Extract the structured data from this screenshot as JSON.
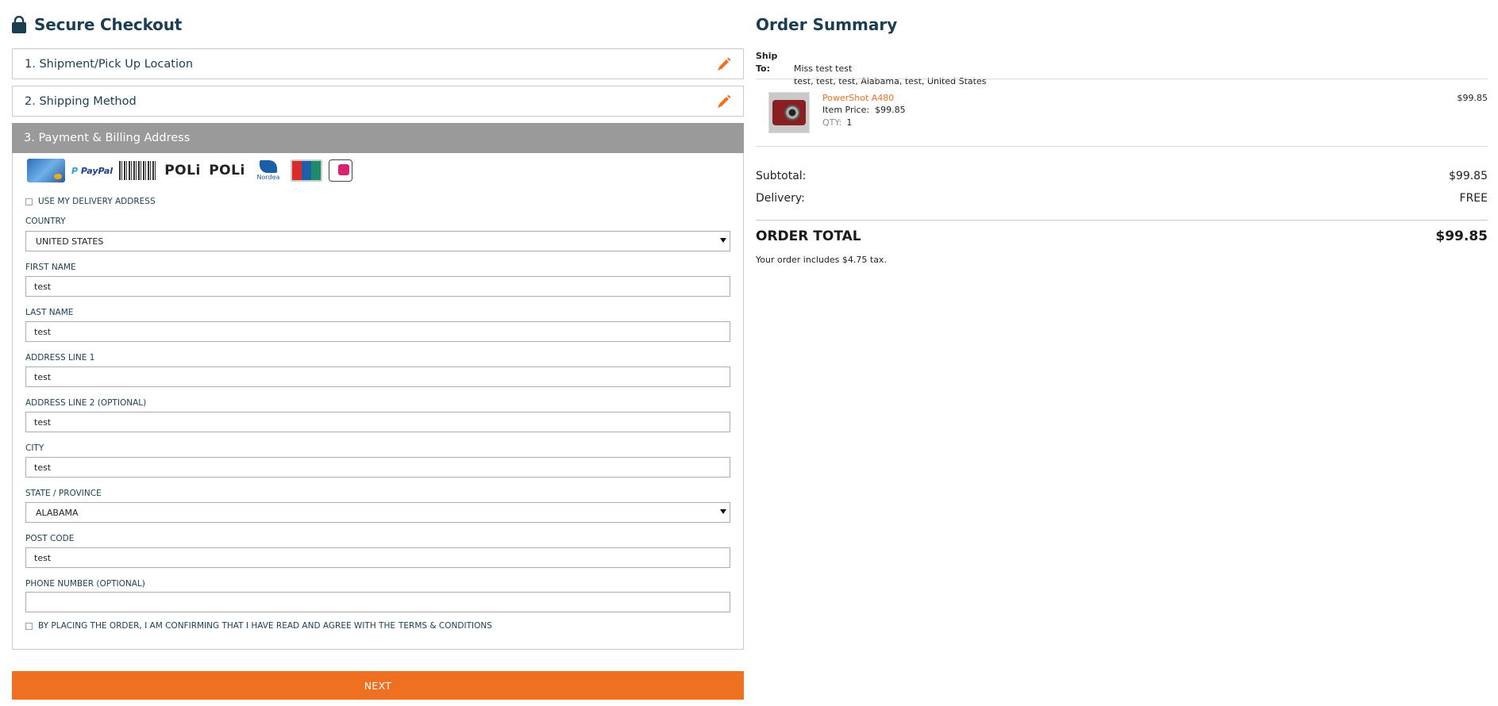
{
  "checkout": {
    "title": "Secure Checkout",
    "steps": [
      {
        "label": "1. Shipment/Pick Up Location"
      },
      {
        "label": "2. Shipping Method"
      },
      {
        "label": "3. Payment & Billing Address"
      }
    ],
    "payment_methods": [
      "credit-card",
      "paypal",
      "boleto-bancario",
      "poli",
      "poli",
      "nordea",
      "unionpay",
      "ideal"
    ],
    "payment_logo_text": {
      "paypal_a": "P",
      "paypal_b": "PayPal",
      "poli": "POLi",
      "nordea": "Nordea"
    },
    "use_delivery_address_label": "USE MY DELIVERY ADDRESS",
    "fields": {
      "country": {
        "label": "COUNTRY",
        "value": "UNITED STATES"
      },
      "first_name": {
        "label": "FIRST NAME",
        "value": "test"
      },
      "last_name": {
        "label": "LAST NAME",
        "value": "test"
      },
      "address1": {
        "label": "ADDRESS LINE 1",
        "value": "test"
      },
      "address2": {
        "label": "ADDRESS LINE 2 (OPTIONAL)",
        "value": "test"
      },
      "city": {
        "label": "CITY",
        "value": "test"
      },
      "state": {
        "label": "STATE / PROVINCE",
        "value": "ALABAMA"
      },
      "post_code": {
        "label": "POST CODE",
        "value": "test"
      },
      "phone": {
        "label": "PHONE NUMBER (OPTIONAL)",
        "value": ""
      }
    },
    "terms_text": "BY PLACING THE ORDER, I AM CONFIRMING THAT I HAVE READ AND AGREE WITH THE",
    "terms_link": "TERMS & CONDITIONS",
    "next_label": "NEXT"
  },
  "summary": {
    "title": "Order Summary",
    "ship_to_label": "Ship To:",
    "ship_to_name": "Miss test test",
    "ship_to_address": "test,  test,  test,  Alabama,  test,  United States",
    "item": {
      "name": "PowerShot A480",
      "price_label": "Item Price:",
      "price": "$99.85",
      "qty_label": "QTY:",
      "qty": "1",
      "line_total": "$99.85"
    },
    "subtotal_label": "Subtotal:",
    "subtotal": "$99.85",
    "delivery_label": "Delivery:",
    "delivery": "FREE",
    "total_label": "ORDER TOTAL",
    "total": "$99.85",
    "tax_note": "Your order includes $4.75 tax."
  },
  "colors": {
    "accent": "#f07022",
    "heading": "#1b3e52",
    "step_active_bg": "#9a9a9a"
  }
}
